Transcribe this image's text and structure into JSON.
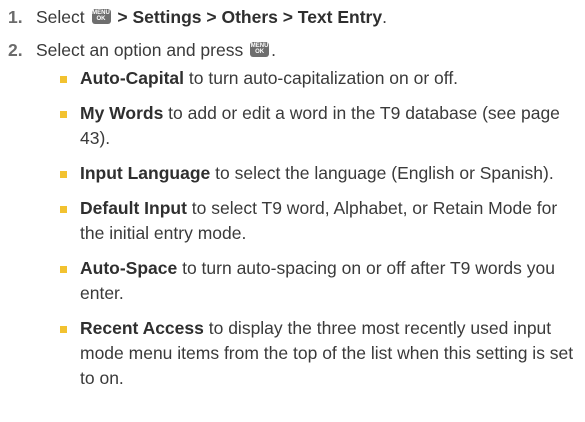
{
  "steps": [
    {
      "number": "1.",
      "prefix": "Select",
      "key_label": [
        "MENU",
        "OK"
      ],
      "path": "> Settings > Others > Text Entry",
      "suffix": "."
    },
    {
      "number": "2.",
      "prefix": "Select an option and press",
      "key_label": [
        "MENU",
        "OK"
      ],
      "suffix": "."
    }
  ],
  "options": [
    {
      "term": "Auto-Capital",
      "text": " to turn auto-capitalization on or off."
    },
    {
      "term": "My Words",
      "text": " to add or edit a word in the T9 database (see page 43)."
    },
    {
      "term": "Input Language",
      "text": " to select the language (English or Spanish)."
    },
    {
      "term": "Default Input",
      "text": " to select T9 word, Alphabet, or Retain Mode for the initial entry mode."
    },
    {
      "term": "Auto-Space",
      "text": " to turn auto-spacing on or off after T9 words you enter."
    },
    {
      "term": "Recent Access",
      "text": " to display the three most recently used input mode menu items from the top of the list when this setting is set to on."
    }
  ],
  "colors": {
    "bullet": "#f2c230",
    "key_bg": "#6e6e6e"
  },
  "icons": {
    "menu_ok_key": "menu-ok-key-icon",
    "bullet": "square-bullet-icon"
  }
}
